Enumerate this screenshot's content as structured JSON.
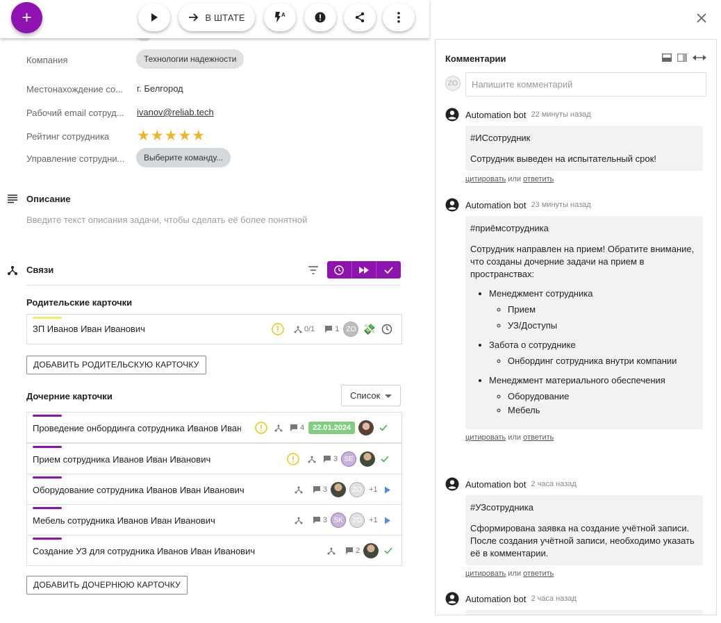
{
  "toolbar": {
    "add_label": "+",
    "status_label": "В ШТАТЕ"
  },
  "fields": [
    {
      "label": "Компания",
      "value": "Технологии надежности"
    },
    {
      "label": "Местонахождение со...",
      "value": "г. Белгород"
    },
    {
      "label": "Рабочий email сотруд...",
      "value": "ivanov@reliab.tech"
    },
    {
      "label": "Рейтинг сотрудника",
      "value": "★★★★★",
      "rating": 5
    },
    {
      "label": "Управление сотрудни...",
      "value": "Выберите команду..."
    }
  ],
  "description": {
    "title": "Описание",
    "placeholder": "Введите текст описания задачи, чтобы сделать её более понятной"
  },
  "links": {
    "title": "Связи",
    "parent_title": "Родительские карточки",
    "parent_cards": [
      {
        "title": "ЗП Иванов Иван Иванович",
        "subtasks": "0/1",
        "comments": "1",
        "avatar": "ZO",
        "bar_color": "#f5ec6a"
      }
    ],
    "add_parent_label": "ДОБАВИТЬ РОДИТЕЛЬСКУЮ КАРТОЧКУ",
    "child_title": "Дочерние карточки",
    "view_select": "Список",
    "child_cards": [
      {
        "title": "Проведение онбординга сотрудника Иванов Иван",
        "comments": "4",
        "date": "22.01.2024",
        "bar_color": "#8e13b0"
      },
      {
        "title": "Прием сотрудника Иванов Иван Иванович",
        "comments": "3",
        "avatar": "SE",
        "bar_color": "#8e13b0"
      },
      {
        "title": "Оборудование сотрудника Иванов Иван Иванович",
        "comments": "3",
        "avatar": "ZO",
        "extra": "+1",
        "bar_color": "#8e13b0"
      },
      {
        "title": "Мебель сотрудника Иванов Иван Иванович",
        "comments": "3",
        "avatar": "SK",
        "avatar2": "ZO",
        "extra": "+1",
        "bar_color": "#8e13b0"
      },
      {
        "title": "Создание УЗ для сотрудника Иванов Иван Иванович",
        "comments": "2",
        "bar_color": "#8e13b0"
      }
    ],
    "add_child_label": "ДОБАВИТЬ ДОЧЕРНЮЮ КАРТОЧКУ"
  },
  "comments": {
    "title": "Комментарии",
    "input_placeholder": "Напишите комментарий",
    "user_avatar": "ZO",
    "quote_label": "цитировать",
    "or_label": "или",
    "reply_label": "ответить",
    "items": [
      {
        "author": "Automation bot",
        "time": "22 минуты назад",
        "tag": "#ИСсотрудник",
        "text": "Сотрудник выведен на испытательный срок!"
      },
      {
        "author": "Automation bot",
        "time": "23 минуты назад",
        "tag": "#приёмсотрудника",
        "text": "Сотрудник направлен на прием! Обратите внимание, что созданы дочерние задачи на прием в пространствах:",
        "list": [
          {
            "name": "Менеджмент сотрудника",
            "sub": [
              "Прием",
              "УЗ/Доступы"
            ]
          },
          {
            "name": "Забота о сотруднике",
            "sub": [
              "Онбординг сотрудника внутри компании"
            ]
          },
          {
            "name": "Менеджмент материального обеспечения",
            "sub": [
              "Оборудование",
              "Мебель"
            ]
          }
        ]
      },
      {
        "author": "Automation bot",
        "time": "2 часа назад",
        "tag": "#УЗсотрудника",
        "text": "Сформирована заявка на создание учётной записи. После создания учётной записи, необходимо указать её в комментарии."
      },
      {
        "author": "Automation bot",
        "time": "2 часа назад"
      }
    ]
  },
  "colors": {
    "accent": "#8e13b0",
    "star": "#f0b428",
    "date_badge": "#7fcf7f"
  }
}
